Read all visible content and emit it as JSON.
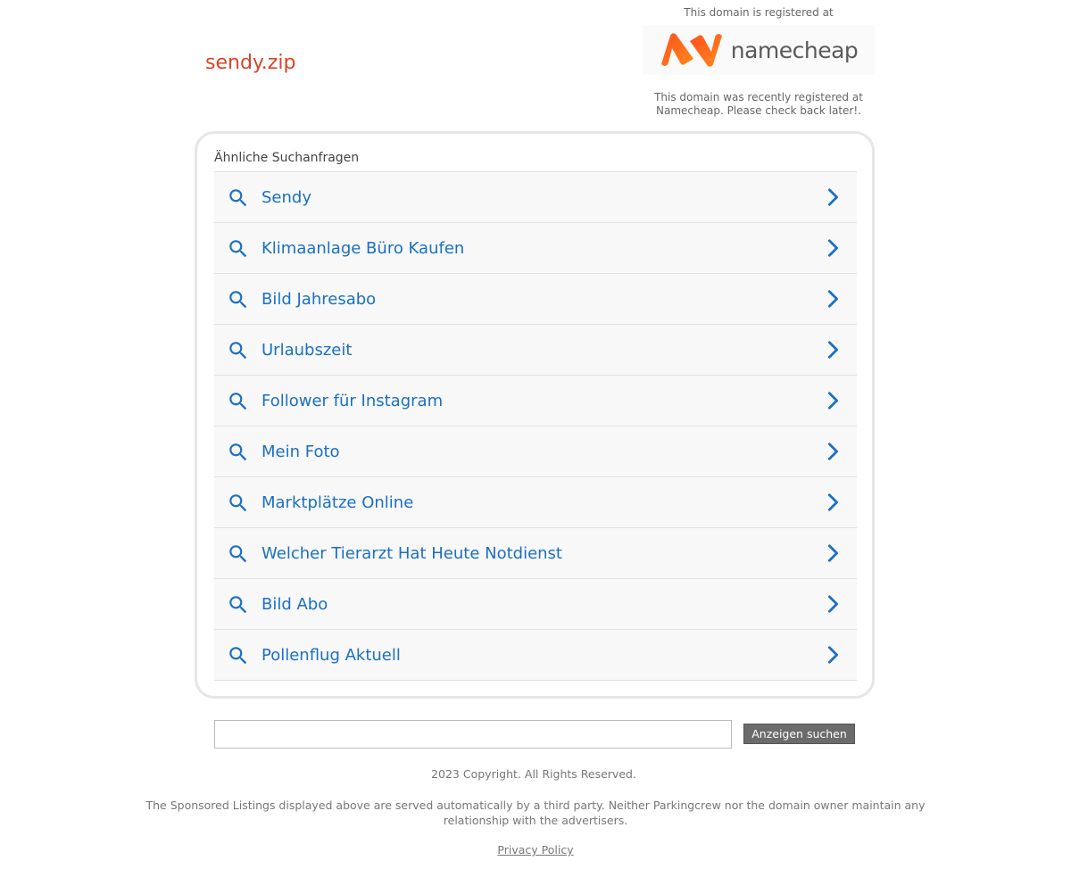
{
  "domain": {
    "name": "sendy.zip"
  },
  "registrar": {
    "top_text": "This domain is registered at",
    "logo_text": "namecheap",
    "bottom_text": "This domain was recently registered at Namecheap. Please check back later!.",
    "brand_color": "#ff6b1a"
  },
  "related": {
    "title": "Ähnliche Suchanfragen",
    "items": [
      {
        "label": "Sendy"
      },
      {
        "label": "Klimaanlage Büro Kaufen"
      },
      {
        "label": "Bild Jahresabo"
      },
      {
        "label": "Urlaubszeit"
      },
      {
        "label": "Follower für Instagram"
      },
      {
        "label": "Mein Foto"
      },
      {
        "label": "Marktplätze Online"
      },
      {
        "label": "Welcher Tierarzt Hat Heute Notdienst"
      },
      {
        "label": "Bild Abo"
      },
      {
        "label": "Pollenflug Aktuell"
      }
    ],
    "link_color": "#1a6fc4",
    "domain_color": "#d9442a"
  },
  "search": {
    "value": "",
    "button_label": "Anzeigen suchen"
  },
  "footer": {
    "copyright": "2023 Copyright. All Rights Reserved.",
    "disclaimer": "The Sponsored Listings displayed above are served automatically by a third party. Neither Parkingcrew nor the domain owner maintain any relationship with the advertisers.",
    "privacy_label": "Privacy Policy"
  }
}
